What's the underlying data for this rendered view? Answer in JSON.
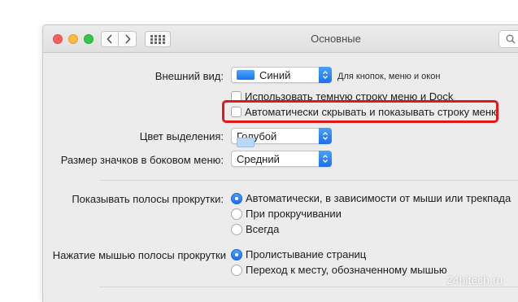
{
  "window": {
    "title": "Основные",
    "traffic_lights": {
      "close": "#fc605c",
      "minimize": "#fdbc40",
      "zoom": "#34c84a"
    },
    "icons": [
      "chevron-left-icon",
      "chevron-right-icon",
      "grid-icon",
      "search-icon"
    ]
  },
  "appearance": {
    "label": "Внешний вид:",
    "value": "Синий",
    "hint": "Для кнопок, меню и окон",
    "dark_menu_checkbox": "Использовать темную строку меню и Dock",
    "autohide_checkbox": "Автоматически скрывать и показывать строку меню"
  },
  "highlight": {
    "label": "Цвет выделения:",
    "value": "Голубой"
  },
  "sidebar_icon_size": {
    "label": "Размер значков в боковом меню:",
    "value": "Средний"
  },
  "scrollbars": {
    "label": "Показывать полосы прокрутки:",
    "options": [
      "Автоматически, в зависимости от мыши или трекпада",
      "При прокручивании",
      "Всегда"
    ],
    "selected_index": 0
  },
  "scroll_click": {
    "label": "Нажатие мышью полосы прокрутки",
    "options": [
      "Пролистывание страниц",
      "Переход к месту, обозначенному мышью"
    ],
    "selected_index": 0
  },
  "watermark": "24hitech.ru",
  "colors": {
    "accent": "#1d6ff0",
    "callout_border": "#e01818"
  }
}
